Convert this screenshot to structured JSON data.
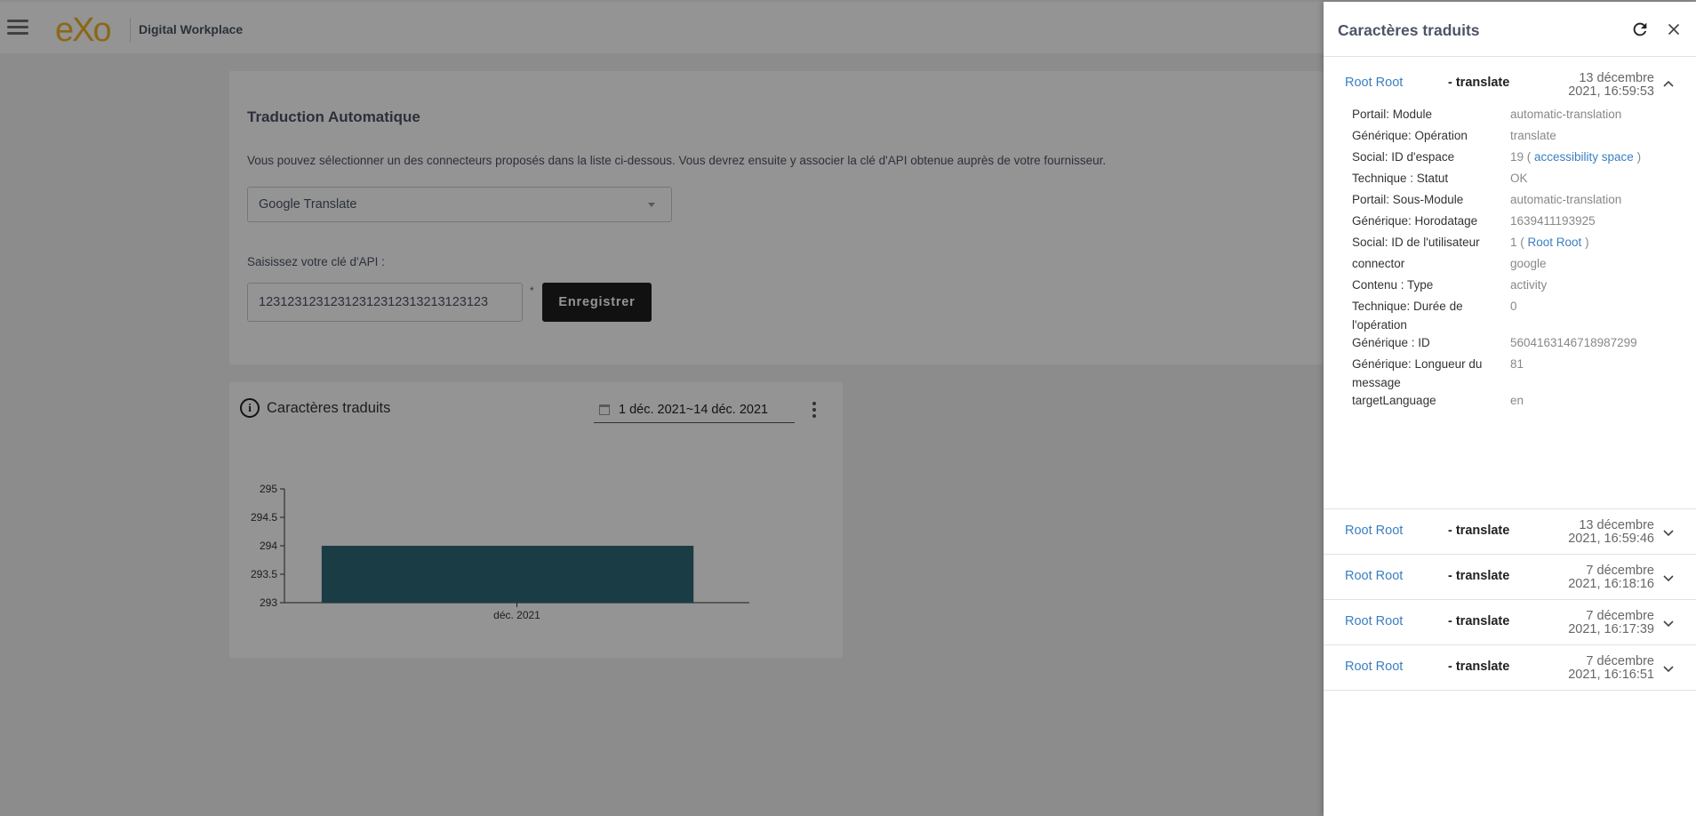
{
  "topbar": {
    "logo_text": "eXo",
    "brand_title": "Digital Workplace"
  },
  "settings": {
    "title": "Traduction Automatique",
    "description": "Vous pouvez sélectionner un des connecteurs proposés dans la liste ci-dessous. Vous devrez ensuite y associer la clé d'API obtenue auprès de votre fournisseur.",
    "connector_selected": "Google Translate",
    "api_label": "Saisissez votre clé d'API :",
    "api_value": "12312312312312312312313213123123",
    "required_mark": "*",
    "save_label": "Enregistrer"
  },
  "chart_card": {
    "title": "Caractères traduits",
    "info_glyph": "i",
    "date_range": "1 déc. 2021~14 déc. 2021"
  },
  "chart_data": {
    "type": "bar",
    "categories": [
      "déc. 2021"
    ],
    "values": [
      294
    ],
    "title": "",
    "xlabel": "",
    "ylabel": "",
    "ylim": [
      293,
      295
    ],
    "yticks": [
      "293",
      "293.5",
      "294",
      "294.5",
      "295"
    ],
    "bar_color": "#2e6a78",
    "grid": false
  },
  "drawer": {
    "title": "Caractères traduits",
    "entries": [
      {
        "user": "Root Root",
        "op": "- translate",
        "date_line1": "13 décembre",
        "date_line2": "2021, 16:59:53",
        "expanded": true
      },
      {
        "user": "Root Root",
        "op": "- translate",
        "date_line1": "13 décembre",
        "date_line2": "2021, 16:59:46",
        "expanded": false
      },
      {
        "user": "Root Root",
        "op": "- translate",
        "date_line1": "7 décembre",
        "date_line2": "2021, 16:18:16",
        "expanded": false
      },
      {
        "user": "Root Root",
        "op": "- translate",
        "date_line1": "7 décembre",
        "date_line2": "2021, 16:17:39",
        "expanded": false
      },
      {
        "user": "Root Root",
        "op": "- translate",
        "date_line1": "7 décembre",
        "date_line2": "2021, 16:16:51",
        "expanded": false
      }
    ],
    "details": [
      {
        "key": "Portail: Module",
        "val": "automatic-translation"
      },
      {
        "key": "Générique: Opération",
        "val": "translate"
      },
      {
        "key": "Social: ID d'espace",
        "val_prefix": "19 ( ",
        "link": "accessibility space",
        "val_suffix": " )"
      },
      {
        "key": "Technique : Statut",
        "val": "OK"
      },
      {
        "key": "Portail: Sous-Module",
        "val": "automatic-translation"
      },
      {
        "key": "Générique: Horodatage",
        "val": "1639411193925"
      },
      {
        "key": "Social: ID de l'utilisateur",
        "val_prefix": "1 ( ",
        "link": "Root Root",
        "val_suffix": " )"
      },
      {
        "key": "connector",
        "val": "google"
      },
      {
        "key": "Contenu : Type",
        "val": "activity"
      },
      {
        "key": "Technique: Durée de l'opération",
        "val": "0"
      },
      {
        "key": "Générique : ID",
        "val": "5604163146718987299"
      },
      {
        "key": "Générique: Longueur du message",
        "val": "81"
      },
      {
        "key": "targetLanguage",
        "val": "en"
      }
    ]
  }
}
